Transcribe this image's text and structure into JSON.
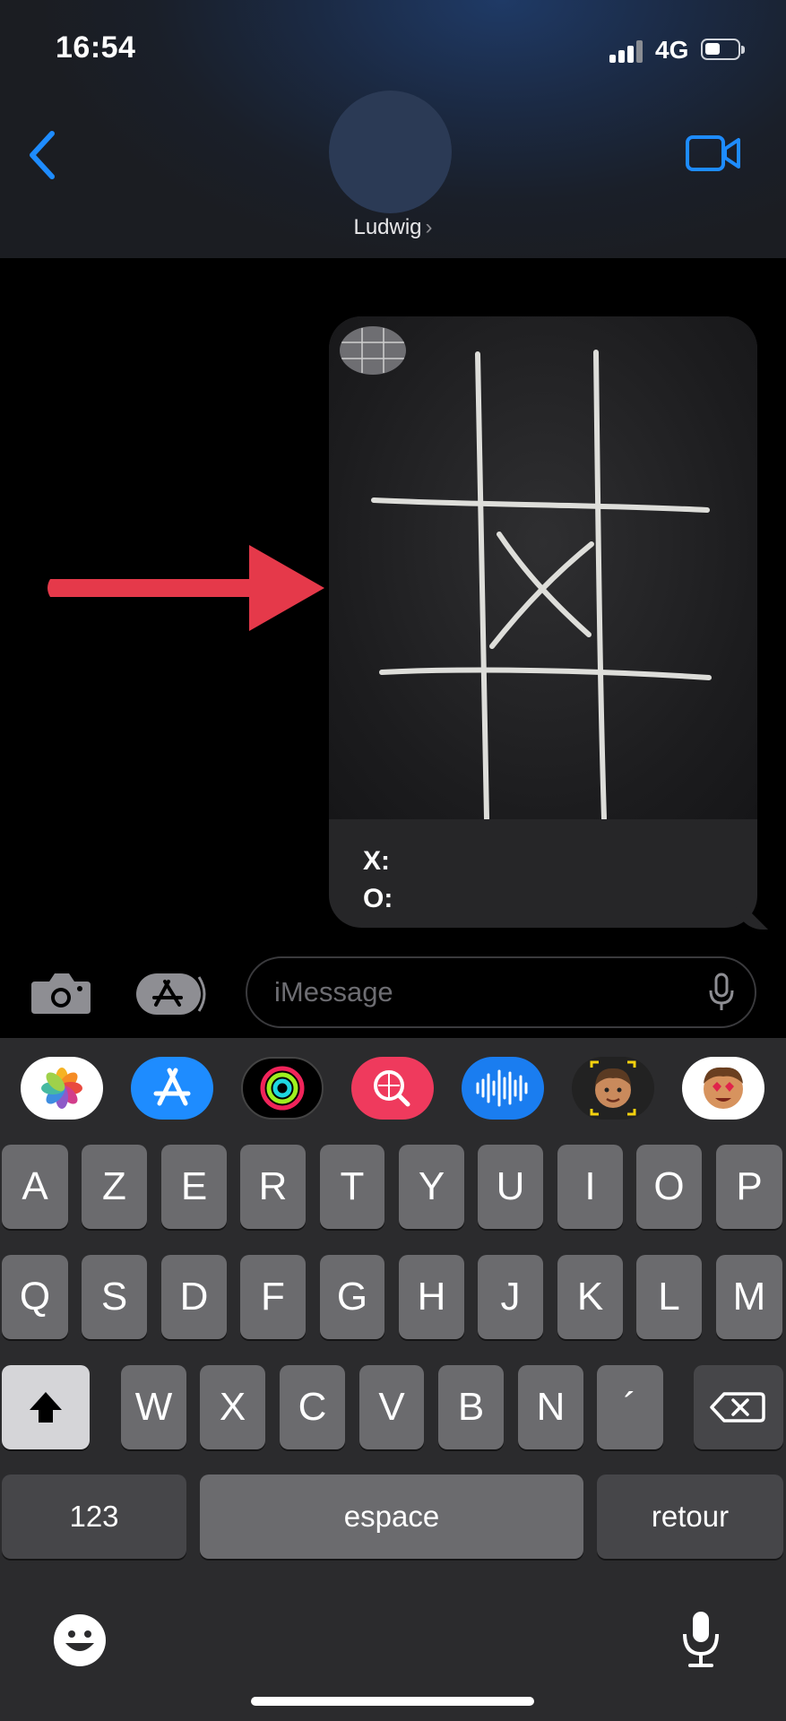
{
  "status_bar": {
    "time": "16:54",
    "network": "4G"
  },
  "header": {
    "contact_name": "Ludwig",
    "chevron": "›",
    "back_icon": "chevron-left-icon",
    "video_icon": "facetime-video-icon"
  },
  "message": {
    "caption_x": "X:",
    "caption_o": "O:",
    "image_icon": "tic-tac-toe-board-image"
  },
  "input_bar": {
    "placeholder": "iMessage",
    "camera_icon": "camera-icon",
    "apps_icon": "app-store-icon",
    "mic_icon": "microphone-icon"
  },
  "app_drawer": {
    "apps": [
      "photos-icon",
      "app-store-icon",
      "activity-icon",
      "web-search-icon",
      "audio-message-icon",
      "memoji-icon",
      "memoji-stickers-icon"
    ]
  },
  "keyboard": {
    "row1": [
      "A",
      "Z",
      "E",
      "R",
      "T",
      "Y",
      "U",
      "I",
      "O",
      "P"
    ],
    "row2": [
      "Q",
      "S",
      "D",
      "F",
      "G",
      "H",
      "J",
      "K",
      "L",
      "M"
    ],
    "row3": [
      "W",
      "X",
      "C",
      "V",
      "B",
      "N",
      "´"
    ],
    "numbers_label": "123",
    "space_label": "espace",
    "return_label": "retour"
  },
  "colors": {
    "accent": "#1e8cff",
    "arrow": "#e5394a",
    "bubble": "#262628",
    "key": "#6b6b6e"
  }
}
